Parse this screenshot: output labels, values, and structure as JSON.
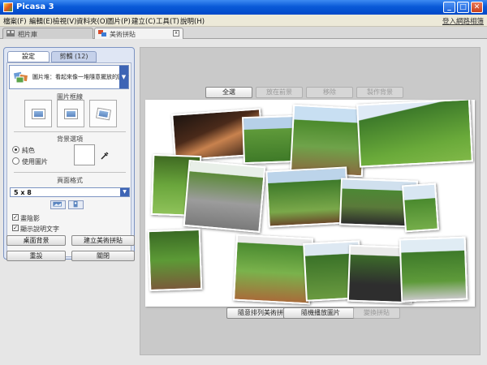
{
  "window": {
    "title": "Picasa 3",
    "controls": {
      "minimize": "_",
      "maximize": "□",
      "close": "✕"
    }
  },
  "menu": {
    "items": [
      "檔案(F)",
      "編輯(E)",
      "檢視(V)",
      "資料夾(O)",
      "圖片(P)",
      "建立(C)",
      "工具(T)",
      "說明(H)"
    ],
    "login_link": "登入網路相簿"
  },
  "tabs": [
    {
      "label": "相片庫",
      "icon": "library-icon"
    },
    {
      "label": "美術拼貼",
      "icon": "collage-icon",
      "close": "x"
    }
  ],
  "panel": {
    "tabs": [
      "設定",
      "剪輯 (12)"
    ],
    "layout_value": "圖片堆：看起來像一堆隨意擺放的圖片",
    "border_section": "圖片框線",
    "background_section": "背景選項",
    "bg_options": [
      "純色",
      "使用圖片"
    ],
    "bg_selected": "純色",
    "format_section": "頁面格式",
    "format_value": "5 x 8",
    "checks": [
      {
        "label": "畫陰影",
        "checked": "✓"
      },
      {
        "label": "顯示說明文字",
        "checked": "✓"
      }
    ],
    "buttons": [
      "桌面背景",
      "建立美術拼貼",
      "重設",
      "關閉"
    ]
  },
  "canvas": {
    "top_buttons": [
      "全選",
      "放在前景",
      "移除",
      "製作背景"
    ],
    "bottom_buttons": [
      "隨意排列美術拼貼",
      "隨機播放圖片",
      "變換拼貼"
    ]
  },
  "colors": {
    "accent": "#3d64b5",
    "titlebar": "#0a5ad8",
    "canvas_bg": "#c9c9c9"
  }
}
